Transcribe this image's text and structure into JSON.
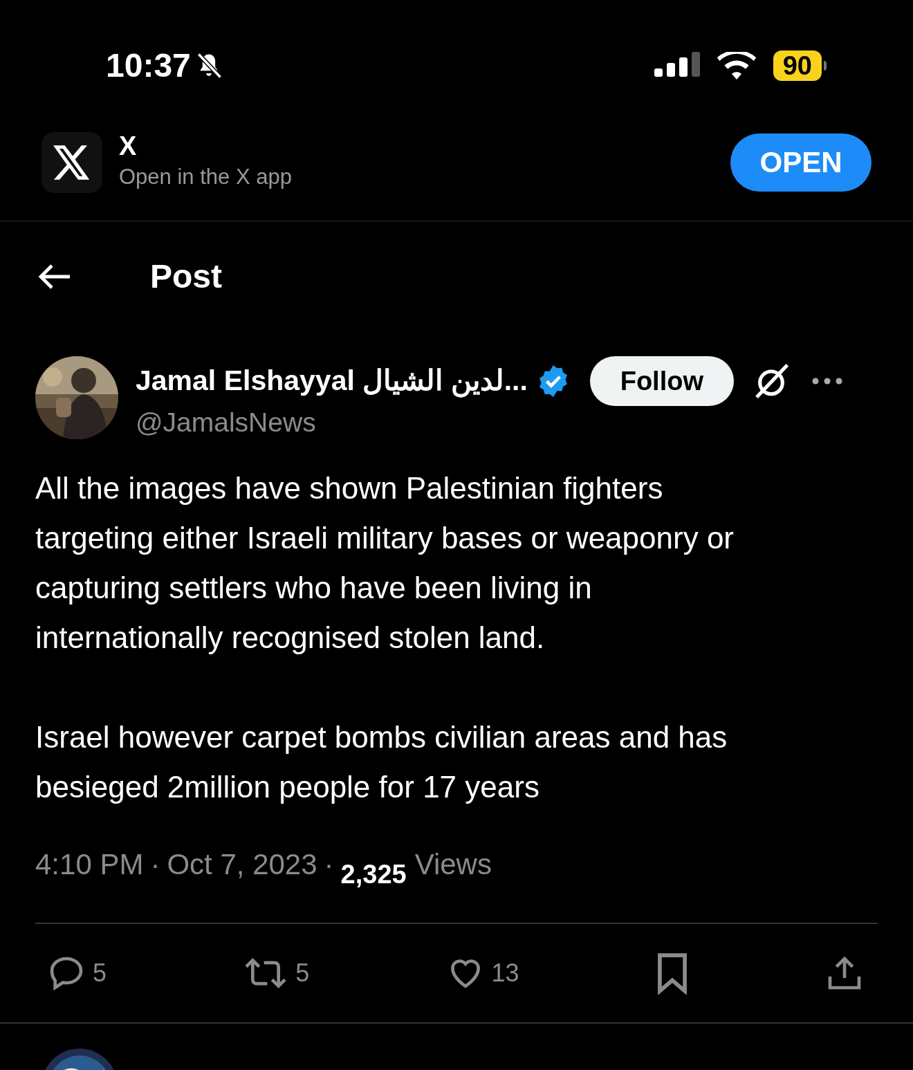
{
  "status_bar": {
    "time": "10:37",
    "battery": "90"
  },
  "app_banner": {
    "name": "X",
    "subtitle": "Open in the X app",
    "button": "OPEN"
  },
  "header": {
    "title": "Post"
  },
  "post": {
    "author": "Jamal Elshayyal لدين الشيال...",
    "handle": "@JamalsNews",
    "verified": true,
    "follow_button": "Follow",
    "paragraphs": [
      "All the images have shown Palestinian fighters targeting either Israeli military bases or weaponry or capturing settlers who have been living in internationally recognised stolen land.",
      "Israel however carpet bombs civilian areas and has besieged 2million people for 17 years"
    ],
    "time": "4:10 PM",
    "separator_1": "·",
    "date": "Oct 7, 2023",
    "separator_2": "·",
    "views_count": "2,325",
    "views_label": "Views",
    "actions": [
      {
        "kind": "reply",
        "count": "5"
      },
      {
        "kind": "repost",
        "count": "5"
      },
      {
        "kind": "like",
        "count": "13"
      },
      {
        "kind": "bookmark"
      },
      {
        "kind": "share"
      }
    ]
  }
}
